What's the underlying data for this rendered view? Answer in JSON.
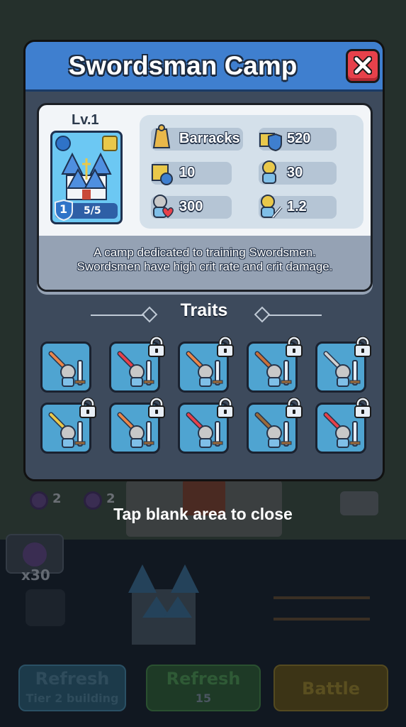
{
  "dialog": {
    "title": "Swordsman Camp",
    "close_icon": "close-x-icon",
    "level": "Lv.1",
    "card": {
      "tier": "1",
      "count": "5/5",
      "icons": [
        "user-icon",
        "grid-icon",
        "castle-icon",
        "shield-icon"
      ]
    },
    "stats": [
      {
        "icon": "barracks-bell-icon",
        "value": "Barracks"
      },
      {
        "icon": "castle-shield-icon",
        "value": "520"
      },
      {
        "icon": "castle-timer-icon",
        "value": "10"
      },
      {
        "icon": "soldier-group-icon",
        "value": "30"
      },
      {
        "icon": "soldier-heart-icon",
        "value": "300"
      },
      {
        "icon": "soldier-sword-icon",
        "value": "1.2"
      }
    ],
    "description_lines": [
      "A camp dedicated to training Swordsmen.",
      "Swordsmen have high crit rate and crit damage."
    ],
    "traits_title": "Traits",
    "traits": [
      {
        "icon": "sword-attack-trait-icon",
        "locked": false
      },
      {
        "icon": "heart-health-trait-icon",
        "locked": true
      },
      {
        "icon": "sword-down-trait-icon",
        "locked": true
      },
      {
        "icon": "axe-up-trait-icon",
        "locked": true
      },
      {
        "icon": "skull-sword-trait-icon",
        "locked": true
      },
      {
        "icon": "sword-up-trait-icon",
        "locked": true
      },
      {
        "icon": "skull-up-trait-icon",
        "locked": true
      },
      {
        "icon": "fire-sword-trait-icon",
        "locked": true
      },
      {
        "icon": "hammer-up-trait-icon",
        "locked": true
      },
      {
        "icon": "heart-aura-trait-icon",
        "locked": true
      }
    ]
  },
  "overlay": {
    "tap_to_close": "Tap blank area to close"
  },
  "background": {
    "coin_counts": [
      "2",
      "2"
    ],
    "multiplier": "x30",
    "buttons": [
      {
        "label": "Refresh",
        "sublabel": "Tier 2 building"
      },
      {
        "label": "Refresh",
        "sublabel": "15"
      },
      {
        "label": "Battle"
      }
    ]
  },
  "colors": {
    "header_blue": "#3f7fcf",
    "close_red": "#e7414b",
    "dialog_body": "#3d4a5c",
    "trait_tile": "#4fa4d1"
  }
}
